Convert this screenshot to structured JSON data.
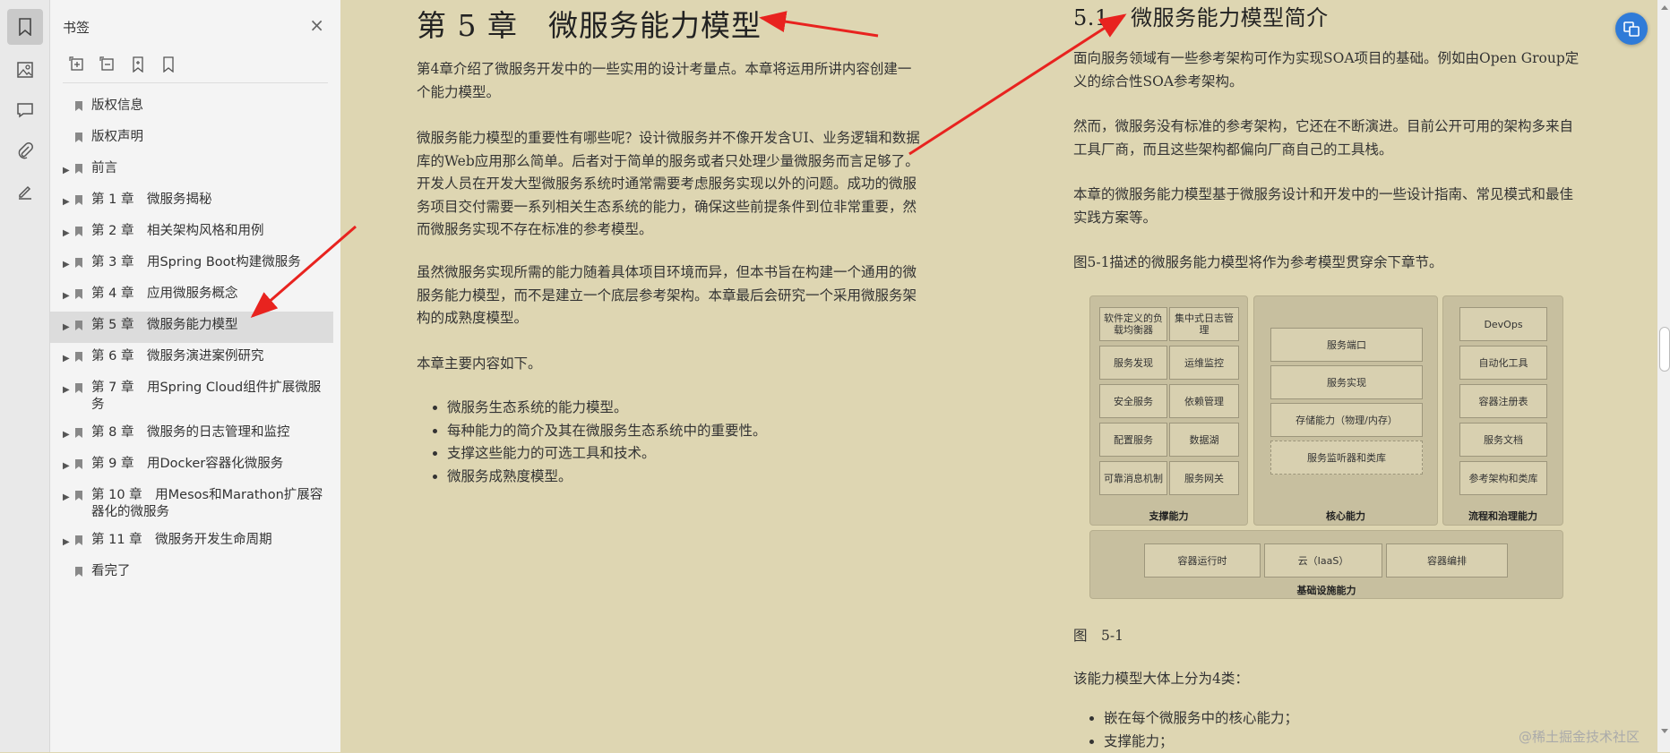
{
  "sidebar": {
    "title": "书签",
    "close_label": "×",
    "toolbar_icons": [
      "expand-all-icon",
      "collapse-all-icon",
      "add-bookmark-icon",
      "bookmark-icon"
    ],
    "items": [
      {
        "label": "版权信息",
        "expandable": false,
        "selected": false
      },
      {
        "label": "版权声明",
        "expandable": false,
        "selected": false
      },
      {
        "label": "前言",
        "expandable": true,
        "selected": false
      },
      {
        "label": "第 1 章　微服务揭秘",
        "expandable": true,
        "selected": false
      },
      {
        "label": "第 2 章　相关架构风格和用例",
        "expandable": true,
        "selected": false
      },
      {
        "label": "第 3 章　用Spring Boot构建微服务",
        "expandable": true,
        "selected": false
      },
      {
        "label": "第 4 章　应用微服务概念",
        "expandable": true,
        "selected": false
      },
      {
        "label": "第 5 章　微服务能力模型",
        "expandable": true,
        "selected": true
      },
      {
        "label": "第 6 章　微服务演进案例研究",
        "expandable": true,
        "selected": false
      },
      {
        "label": "第 7 章　用Spring Cloud组件扩展微服务",
        "expandable": true,
        "selected": false
      },
      {
        "label": "第 8 章　微服务的日志管理和监控",
        "expandable": true,
        "selected": false
      },
      {
        "label": "第 9 章　用Docker容器化微服务",
        "expandable": true,
        "selected": false
      },
      {
        "label": "第 10 章　用Mesos和Marathon扩展容器化的微服务",
        "expandable": true,
        "selected": false
      },
      {
        "label": "第 11 章　微服务开发生命周期",
        "expandable": true,
        "selected": false
      },
      {
        "label": "看完了",
        "expandable": false,
        "selected": false
      }
    ]
  },
  "left_page": {
    "chapter_title": "第 5 章　微服务能力模型",
    "paragraphs": [
      "第4章介绍了微服务开发中的一些实用的设计考量点。本章将运用所讲内容创建一个能力模型。",
      "微服务能力模型的重要性有哪些呢？设计微服务并不像开发含UI、业务逻辑和数据库的Web应用那么简单。后者对于简单的服务或者只处理少量微服务而言足够了。开发人员在开发大型微服务系统时通常需要考虑服务实现以外的问题。成功的微服务项目交付需要一系列相关生态系统的能力，确保这些前提条件到位非常重要，然而微服务实现不存在标准的参考模型。",
      "虽然微服务实现所需的能力随着具体项目环境而异，但本书旨在构建一个通用的微服务能力模型，而不是建立一个底层参考架构。本章最后会研究一个采用微服务架构的成熟度模型。",
      "本章主要内容如下。"
    ],
    "bullets": [
      "微服务生态系统的能力模型。",
      "每种能力的简介及其在微服务生态系统中的重要性。",
      "支撑这些能力的可选工具和技术。",
      "微服务成熟度模型。"
    ]
  },
  "right_page": {
    "section_title": "5.1　微服务能力模型简介",
    "paragraphs": [
      "面向服务领域有一些参考架构可作为实现SOA项目的基础。例如由Open Group定义的综合性SOA参考架构。",
      "然而，微服务没有标准的参考架构，它还在不断演进。目前公开可用的架构多来自工具厂商，而且这些架构都偏向厂商自己的工具栈。",
      "本章的微服务能力模型基于微服务设计和开发中的一些设计指南、常见模式和最佳实践方案等。",
      "图5-1描述的微服务能力模型将作为参考模型贯穿余下章节。"
    ],
    "figure": {
      "support": {
        "label": "支撑能力",
        "cells": [
          "软件定义的负载均衡器",
          "集中式日志管理",
          "服务发现",
          "运维监控",
          "安全服务",
          "依赖管理",
          "配置服务",
          "数据湖",
          "可靠消息机制",
          "服务网关"
        ]
      },
      "core": {
        "label": "核心能力",
        "cells": [
          "服务端口",
          "服务实现",
          "存储能力（物理/内存）",
          "服务监听器和类库"
        ]
      },
      "process": {
        "label": "流程和治理能力",
        "cells": [
          "DevOps",
          "自动化工具",
          "容器注册表",
          "服务文档",
          "参考架构和类库"
        ]
      },
      "infra": {
        "label": "基础设施能力",
        "cells": [
          "容器运行时",
          "云（IaaS）",
          "容器编排"
        ]
      }
    },
    "figure_caption": "图　5-1",
    "after_text": "该能力模型大体上分为4类：",
    "bullets": [
      "嵌在每个微服务中的核心能力；",
      "支撑能力；"
    ]
  },
  "watermark": "@稀土掘金技术社区",
  "colors": {
    "page_bg": "#ded6b2",
    "sidebar_bg": "#f4f4f4",
    "selected_item": "#dcdcdc",
    "annotation_arrow": "#e8231f",
    "float_button": "#2f7bd8"
  }
}
